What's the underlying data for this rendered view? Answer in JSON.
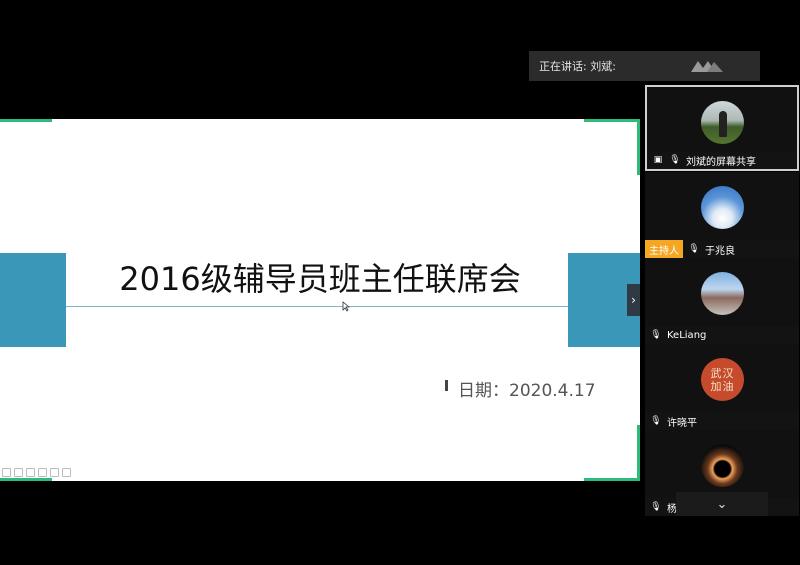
{
  "speaking": {
    "label": "正在讲话: 刘斌:"
  },
  "slide": {
    "title": "2016级辅导员班主任联席会",
    "date": "日期：2020.4.17",
    "accent_color": "#3a97b8",
    "corner_color": "#2dba7a"
  },
  "next_icon": "chevron-right-icon",
  "participants": [
    {
      "name": "刘斌的屏幕共享",
      "icons": [
        "screen-share-icon",
        "microphone-icon"
      ],
      "active": true
    },
    {
      "name": "于兆良",
      "badge": "主持人",
      "icons": [
        "microphone-icon"
      ]
    },
    {
      "name": "KeLiang",
      "icons": [
        "microphone-muted-icon"
      ]
    },
    {
      "name": "许晓平",
      "icons": [
        "microphone-muted-icon"
      ],
      "avatar_text": [
        "武汉",
        "加油"
      ]
    },
    {
      "name": "杨皓东",
      "icons": [
        "microphone-muted-icon"
      ]
    }
  ],
  "collapse_icon": "chevron-down-icon"
}
